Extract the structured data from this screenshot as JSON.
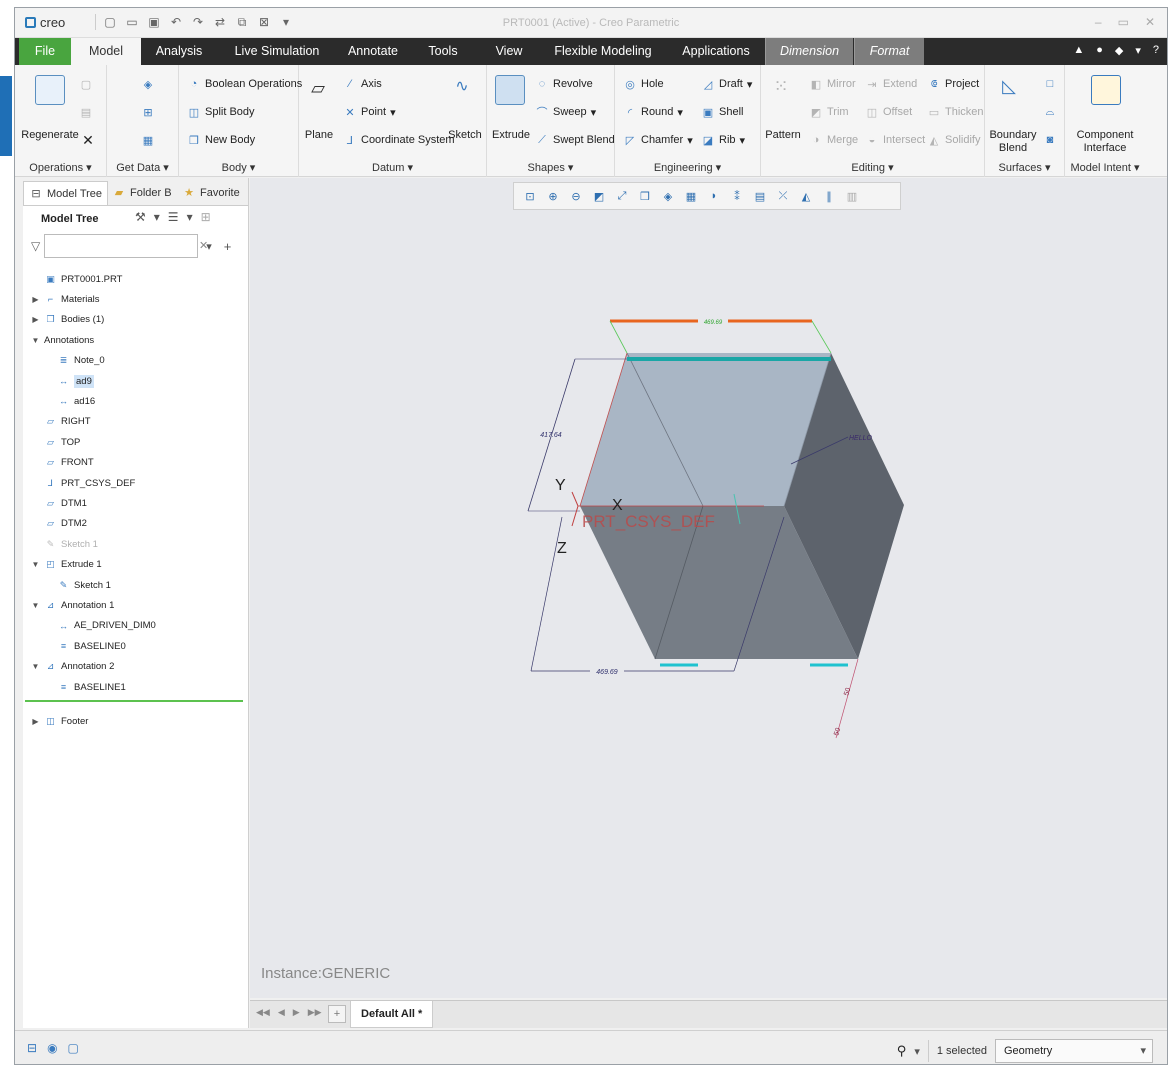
{
  "app": {
    "logo_text": "creo",
    "window_title": "PRT0001 (Active) - Creo Parametric"
  },
  "tabs": {
    "file": "File",
    "model": "Model",
    "analysis": "Analysis",
    "live_simulation": "Live Simulation",
    "annotate": "Annotate",
    "tools": "Tools",
    "view": "View",
    "flexible_modeling": "Flexible Modeling",
    "applications": "Applications",
    "dimension": "Dimension",
    "format": "Format"
  },
  "ribbon": {
    "operations": {
      "regenerate": "Regenerate",
      "label": "Operations ▾"
    },
    "get_data": {
      "label": "Get Data ▾"
    },
    "body": {
      "boolean": "Boolean Operations",
      "split": "Split Body",
      "new": "New Body",
      "label": "Body ▾"
    },
    "datum": {
      "plane": "Plane",
      "axis": "Axis",
      "point": "Point",
      "csys": "Coordinate System",
      "sketch": "Sketch",
      "label": "Datum ▾"
    },
    "shapes": {
      "extrude": "Extrude",
      "revolve": "Revolve",
      "sweep": "Sweep",
      "swept_blend": "Swept Blend",
      "label": "Shapes ▾"
    },
    "engineering": {
      "hole": "Hole",
      "draft": "Draft",
      "round": "Round",
      "shell": "Shell",
      "chamfer": "Chamfer",
      "rib": "Rib",
      "label": "Engineering ▾"
    },
    "editing": {
      "pattern": "Pattern",
      "mirror": "Mirror",
      "extend": "Extend",
      "project": "Project",
      "trim": "Trim",
      "offset": "Offset",
      "thicken": "Thicken",
      "merge": "Merge",
      "intersect": "Intersect",
      "solidify": "Solidify",
      "label": "Editing ▾"
    },
    "surfaces": {
      "boundary_blend_1": "Boundary",
      "boundary_blend_2": "Blend",
      "label": "Surfaces ▾"
    },
    "model_intent": {
      "component_1": "Component",
      "component_2": "Interface",
      "label": "Model Intent ▾"
    }
  },
  "panel": {
    "tabs": {
      "model_tree": "Model Tree",
      "folder": "Folder B",
      "favorite": "Favorite"
    },
    "title": "Model Tree",
    "search_placeholder": ""
  },
  "tree": [
    {
      "label": "PRT0001.PRT",
      "depth": 0,
      "icon": "part-icon",
      "twisty": ""
    },
    {
      "label": "Materials",
      "depth": 0,
      "icon": "materials-icon",
      "twisty": "▶"
    },
    {
      "label": "Bodies (1)",
      "depth": 0,
      "icon": "bodies-icon",
      "twisty": "▶"
    },
    {
      "label": "Annotations",
      "depth": 0,
      "icon": "",
      "twisty": "▼"
    },
    {
      "label": "Note_0",
      "depth": 2,
      "icon": "note-icon",
      "twisty": ""
    },
    {
      "label": "ad9",
      "depth": 2,
      "icon": "dimension-icon",
      "twisty": "",
      "selected": true
    },
    {
      "label": "ad16",
      "depth": 2,
      "icon": "dimension-icon",
      "twisty": ""
    },
    {
      "label": "RIGHT",
      "depth": 0,
      "icon": "plane-icon",
      "twisty": ""
    },
    {
      "label": "TOP",
      "depth": 0,
      "icon": "plane-icon",
      "twisty": ""
    },
    {
      "label": "FRONT",
      "depth": 0,
      "icon": "plane-icon",
      "twisty": ""
    },
    {
      "label": "PRT_CSYS_DEF",
      "depth": 0,
      "icon": "csys-icon",
      "twisty": ""
    },
    {
      "label": "DTM1",
      "depth": 0,
      "icon": "plane-icon",
      "twisty": ""
    },
    {
      "label": "DTM2",
      "depth": 0,
      "icon": "plane-icon",
      "twisty": ""
    },
    {
      "label": "Sketch 1",
      "depth": 0,
      "icon": "sketch-icon",
      "twisty": "",
      "disabled": true
    },
    {
      "label": "Extrude 1",
      "depth": 0,
      "icon": "extrude-icon",
      "twisty": "▼"
    },
    {
      "label": "Sketch 1",
      "depth": 2,
      "icon": "sketch-icon",
      "twisty": ""
    },
    {
      "label": "Annotation 1",
      "depth": 0,
      "icon": "annotation-icon",
      "twisty": "▼"
    },
    {
      "label": "AE_DRIVEN_DIM0",
      "depth": 2,
      "icon": "dimension-icon",
      "twisty": ""
    },
    {
      "label": "BASELINE0",
      "depth": 2,
      "icon": "baseline-icon",
      "twisty": ""
    },
    {
      "label": "Annotation 2",
      "depth": 0,
      "icon": "annotation-icon",
      "twisty": "▼"
    },
    {
      "label": "BASELINE1",
      "depth": 2,
      "icon": "baseline-icon",
      "twisty": ""
    },
    {
      "label": "Footer",
      "depth": 0,
      "icon": "footer-icon",
      "twisty": "▶"
    }
  ],
  "viewport": {
    "instance": "Instance:GENERIC",
    "dims": {
      "top": "469.69",
      "left": "417.64",
      "bottom": "469.69",
      "right_a": "50",
      "right_b": "50"
    },
    "note": "HELLO",
    "axes": {
      "x": "X",
      "y": "Y",
      "z": "Z",
      "csys": "PRT_CSYS_DEF"
    }
  },
  "bottom": {
    "tab": "Default All *"
  },
  "status": {
    "selected": "1 selected",
    "filter": "Geometry"
  },
  "colors": {
    "file_tab": "#49a53f",
    "tab_bar": "#2b2b2b",
    "accent": "#3a7bbf",
    "dim_orange": "#e8651f",
    "dim_teal": "#1aa6a6",
    "face_light": "#a9b6c5",
    "face_dark": "#5d636c",
    "face_mid": "#767d86"
  }
}
